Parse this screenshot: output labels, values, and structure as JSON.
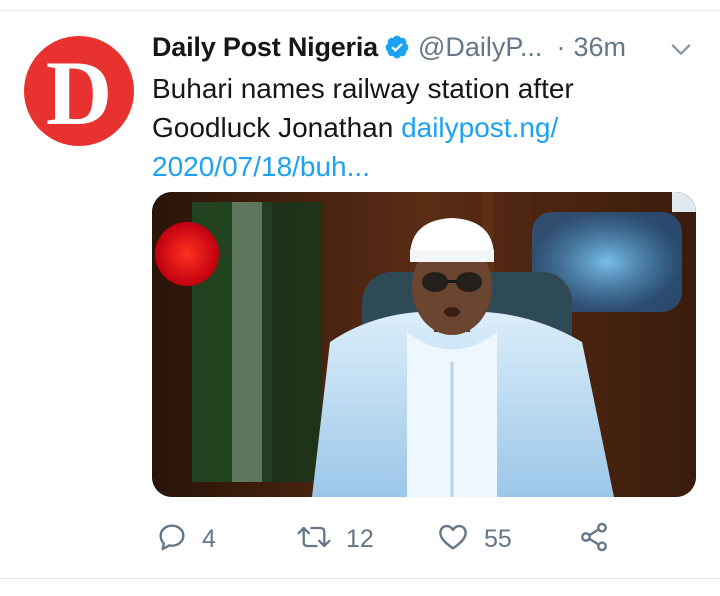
{
  "tweet": {
    "author_name": "Daily Post Nigeria",
    "handle": "@DailyP...",
    "separator": "·",
    "time": "36m",
    "text": "Buhari names railway station after Goodluck Jonathan",
    "link_line1": "dailypost.ng/",
    "link_line2": "2020/07/18/buh...",
    "avatar_letter": "D"
  },
  "actions": {
    "replies": "4",
    "retweets": "12",
    "likes": "55"
  },
  "colors": {
    "avatar": "#e8322f",
    "link": "#1da1f2",
    "verified": "#1da1f2",
    "muted": "#657786"
  }
}
